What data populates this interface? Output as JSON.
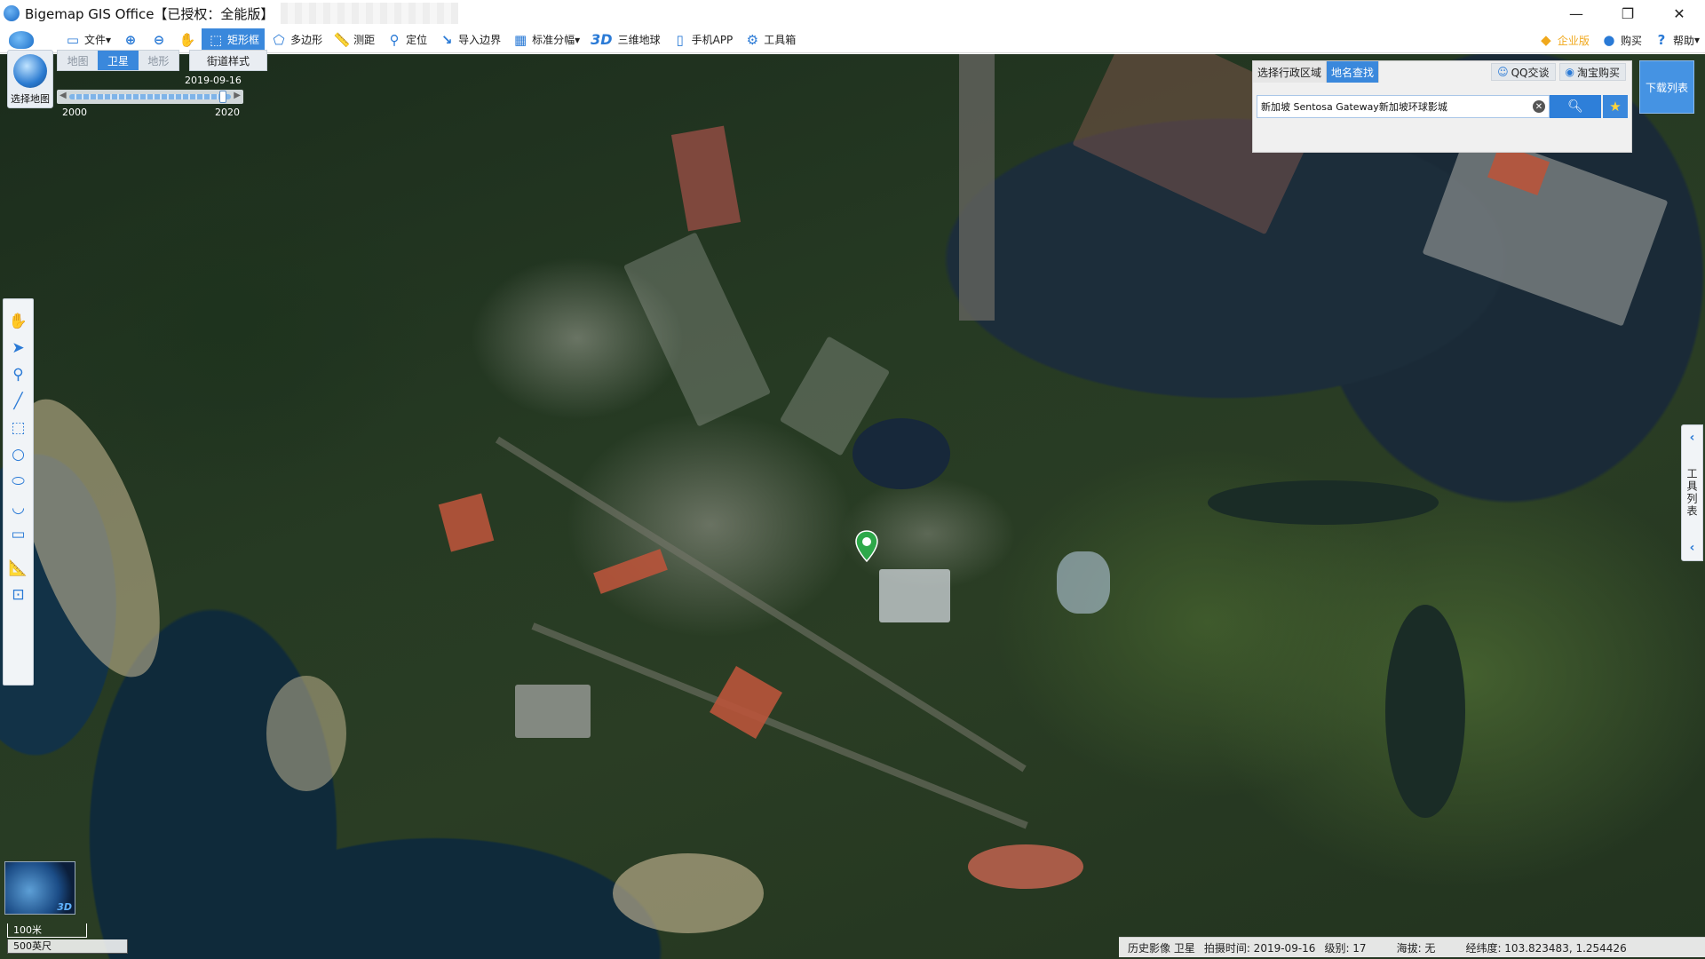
{
  "window": {
    "title": "Bigemap GIS Office【已授权：全能版】",
    "controls": {
      "minimize": "—",
      "restore": "❐",
      "close": "✕"
    }
  },
  "toolbar": {
    "file": "文件",
    "rect_select": "矩形框",
    "polygon": "多边形",
    "measure": "测距",
    "locate": "定位",
    "import_boundary": "导入边界",
    "standard_grid": "标准分幅",
    "globe_3d_prefix": "3D",
    "globe_3d": "三维地球",
    "mobile_app": "手机APP",
    "toolbox": "工具箱",
    "enterprise": "企业版",
    "buy": "购买",
    "help": "帮助"
  },
  "map_panel": {
    "select_map_label": "选择地图",
    "tabs": [
      {
        "label": "地图",
        "active": false
      },
      {
        "label": "卫星",
        "active": true
      },
      {
        "label": "地形",
        "active": false
      }
    ],
    "street_style": "街道样式",
    "timeline": {
      "current_date": "2019-09-16",
      "start_year": "2000",
      "end_year": "2020",
      "position": 0.95
    }
  },
  "search": {
    "tabs": [
      {
        "label": "选择行政区域",
        "active": false
      },
      {
        "label": "地名查找",
        "active": true
      }
    ],
    "qq_label": "QQ交谈",
    "taobao_label": "淘宝购买",
    "query": "新加坡 Sentosa Gateway新加坡环球影城",
    "download_list": "下载列表"
  },
  "tool_list_tab": "工具列表",
  "overview": {
    "tag": "3D"
  },
  "scale": {
    "metric": "100米",
    "imperial": "500英尺"
  },
  "status_bar": {
    "history": "历史影像 卫星",
    "capture_time": "拍摄时间: 2019-09-16",
    "level": "级别:  17",
    "altitude": "海拔: 无",
    "coords": "经纬度:   103.823483, 1.254426"
  },
  "colors": {
    "accent": "#3a88dc",
    "marker": "#2ea84a"
  }
}
